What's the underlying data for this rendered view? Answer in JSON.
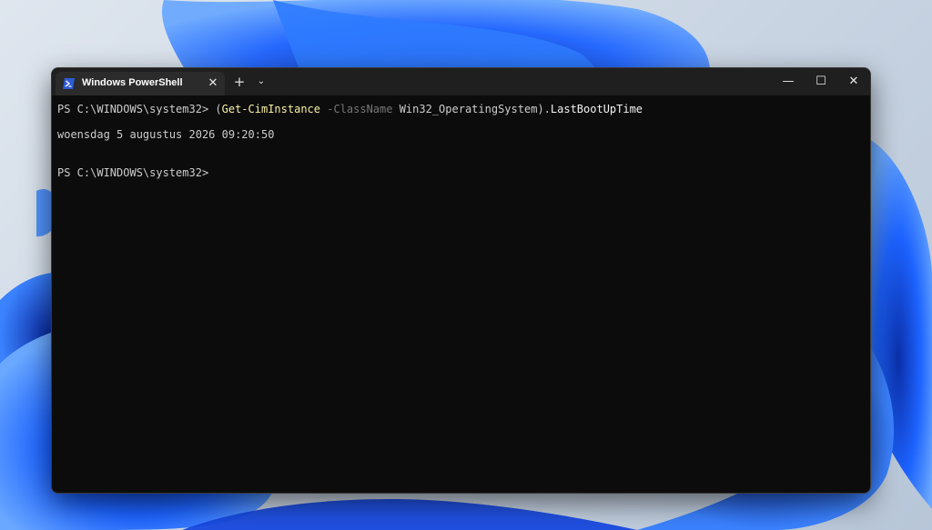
{
  "window": {
    "tab_title": "Windows PowerShell",
    "tab_icon": "powershell-icon",
    "close_tab_glyph": "✕",
    "new_tab_glyph": "+",
    "dropdown_glyph": "⌄",
    "minimize_glyph": "—",
    "maximize_glyph": "☐",
    "close_glyph": "✕"
  },
  "console": {
    "prompt": "PS C:\\WINDOWS\\system32> ",
    "command_open_paren": "(",
    "command_name": "Get-CimInstance",
    "command_param": " -ClassName",
    "command_arg": " Win32_OperatingSystem",
    "command_close_paren": ").",
    "command_prop": "LastBootUpTime",
    "output": "woensdag 5 augustus 2026 09:20:50",
    "final_prompt": "PS C:\\WINDOWS\\system32>"
  },
  "colors": {
    "terminal_bg": "#0c0c0c",
    "titlebar_bg": "#1f1f1f",
    "tab_bg": "#2b2b2b",
    "cmd_name": "#f9f1a5",
    "cmd_param": "#767676",
    "text": "#cccccc",
    "wallpaper_blue": "#1a5cff"
  }
}
